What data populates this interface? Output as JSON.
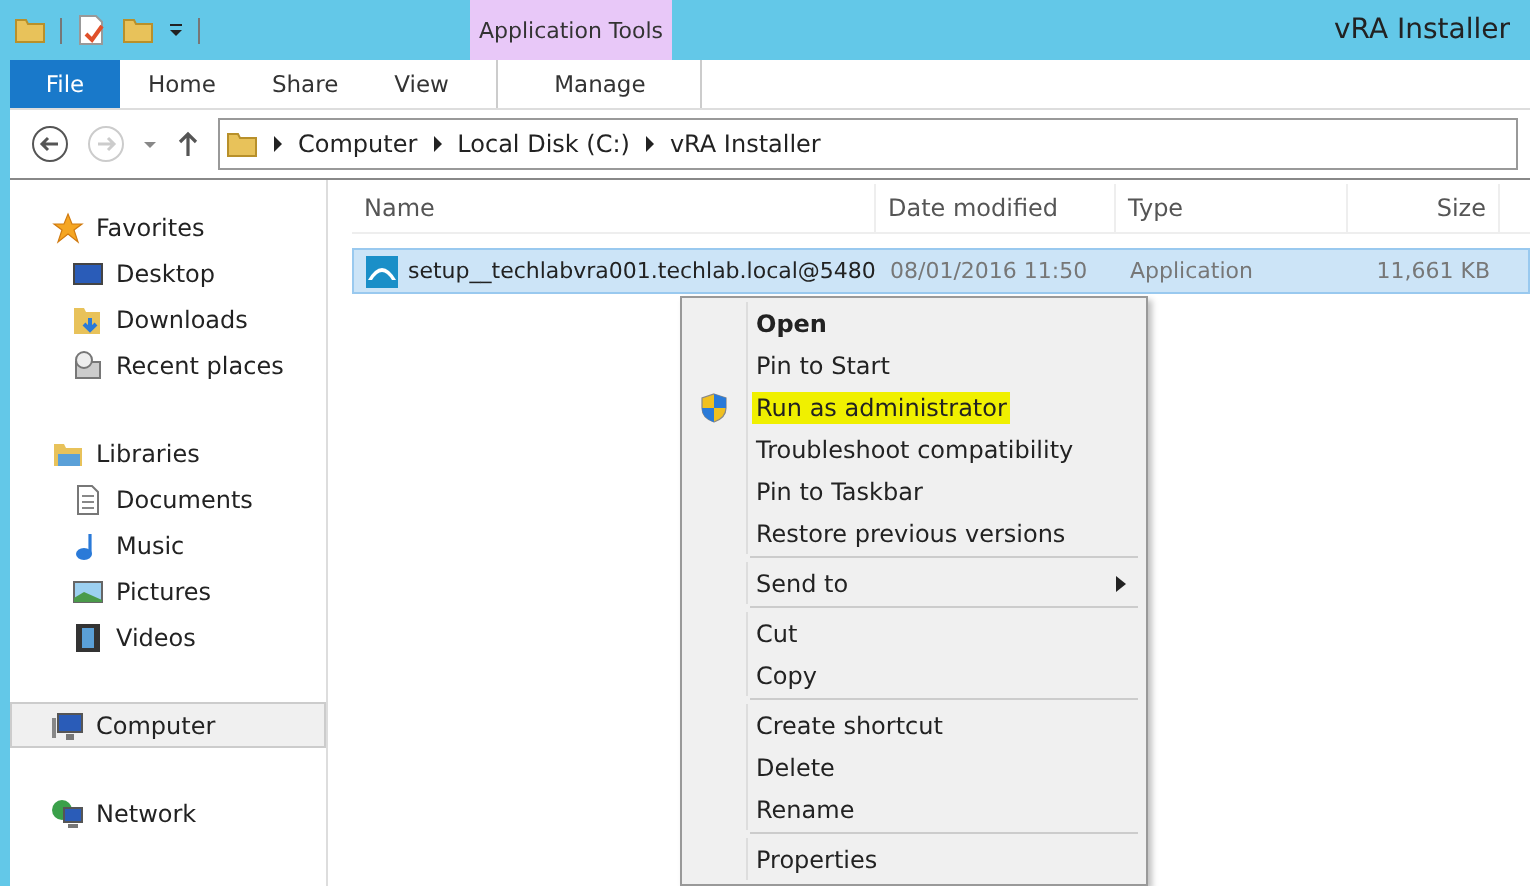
{
  "window": {
    "title": "vRA Installer"
  },
  "context_tab": {
    "group": "Application Tools"
  },
  "ribbon_tabs": [
    {
      "label": "File",
      "kind": "file",
      "selected": false
    },
    {
      "label": "Home",
      "kind": "tab",
      "selected": false
    },
    {
      "label": "Share",
      "kind": "tab",
      "selected": false
    },
    {
      "label": "View",
      "kind": "tab",
      "selected": false
    },
    {
      "label": "Manage",
      "kind": "context",
      "selected": false
    }
  ],
  "breadcrumb": [
    "Computer",
    "Local Disk (C:)",
    "vRA Installer"
  ],
  "sidebar": {
    "groups": [
      {
        "label": "Favorites",
        "selected": false,
        "children": [
          {
            "label": "Desktop",
            "selected": false
          },
          {
            "label": "Downloads",
            "selected": false
          },
          {
            "label": "Recent places",
            "selected": false
          }
        ]
      },
      {
        "label": "Libraries",
        "selected": false,
        "children": [
          {
            "label": "Documents",
            "selected": false
          },
          {
            "label": "Music",
            "selected": false
          },
          {
            "label": "Pictures",
            "selected": false
          },
          {
            "label": "Videos",
            "selected": false
          }
        ]
      },
      {
        "label": "Computer",
        "selected": true
      },
      {
        "label": "Network",
        "selected": false
      }
    ]
  },
  "table": {
    "columns": [
      "Name",
      "Date modified",
      "Type",
      "Size"
    ],
    "rows": [
      {
        "name": "setup__techlabvra001.techlab.local@5480",
        "date": "08/01/2016 11:50",
        "type": "Application",
        "size": "11,661 KB",
        "selected": true
      }
    ]
  },
  "context_menu": [
    {
      "kind": "item",
      "label": "Open",
      "bold": true,
      "shield": false,
      "highlighted": false
    },
    {
      "kind": "item",
      "label": "Pin to Start",
      "bold": false,
      "shield": false,
      "highlighted": false
    },
    {
      "kind": "item",
      "label": "Run as administrator",
      "bold": false,
      "shield": true,
      "highlighted": true
    },
    {
      "kind": "item",
      "label": "Troubleshoot compatibility",
      "bold": false,
      "shield": false,
      "highlighted": false
    },
    {
      "kind": "item",
      "label": "Pin to Taskbar",
      "bold": false,
      "shield": false,
      "highlighted": false
    },
    {
      "kind": "item",
      "label": "Restore previous versions",
      "bold": false,
      "shield": false,
      "highlighted": false
    },
    {
      "kind": "separator"
    },
    {
      "kind": "submenu",
      "label": "Send to",
      "bold": false,
      "shield": false,
      "highlighted": false
    },
    {
      "kind": "separator"
    },
    {
      "kind": "item",
      "label": "Cut",
      "bold": false,
      "shield": false,
      "highlighted": false
    },
    {
      "kind": "item",
      "label": "Copy",
      "bold": false,
      "shield": false,
      "highlighted": false
    },
    {
      "kind": "separator"
    },
    {
      "kind": "item",
      "label": "Create shortcut",
      "bold": false,
      "shield": false,
      "highlighted": false
    },
    {
      "kind": "item",
      "label": "Delete",
      "bold": false,
      "shield": false,
      "highlighted": false
    },
    {
      "kind": "item",
      "label": "Rename",
      "bold": false,
      "shield": false,
      "highlighted": false
    },
    {
      "kind": "separator"
    },
    {
      "kind": "item",
      "label": "Properties",
      "bold": false,
      "shield": false,
      "highlighted": false
    }
  ]
}
